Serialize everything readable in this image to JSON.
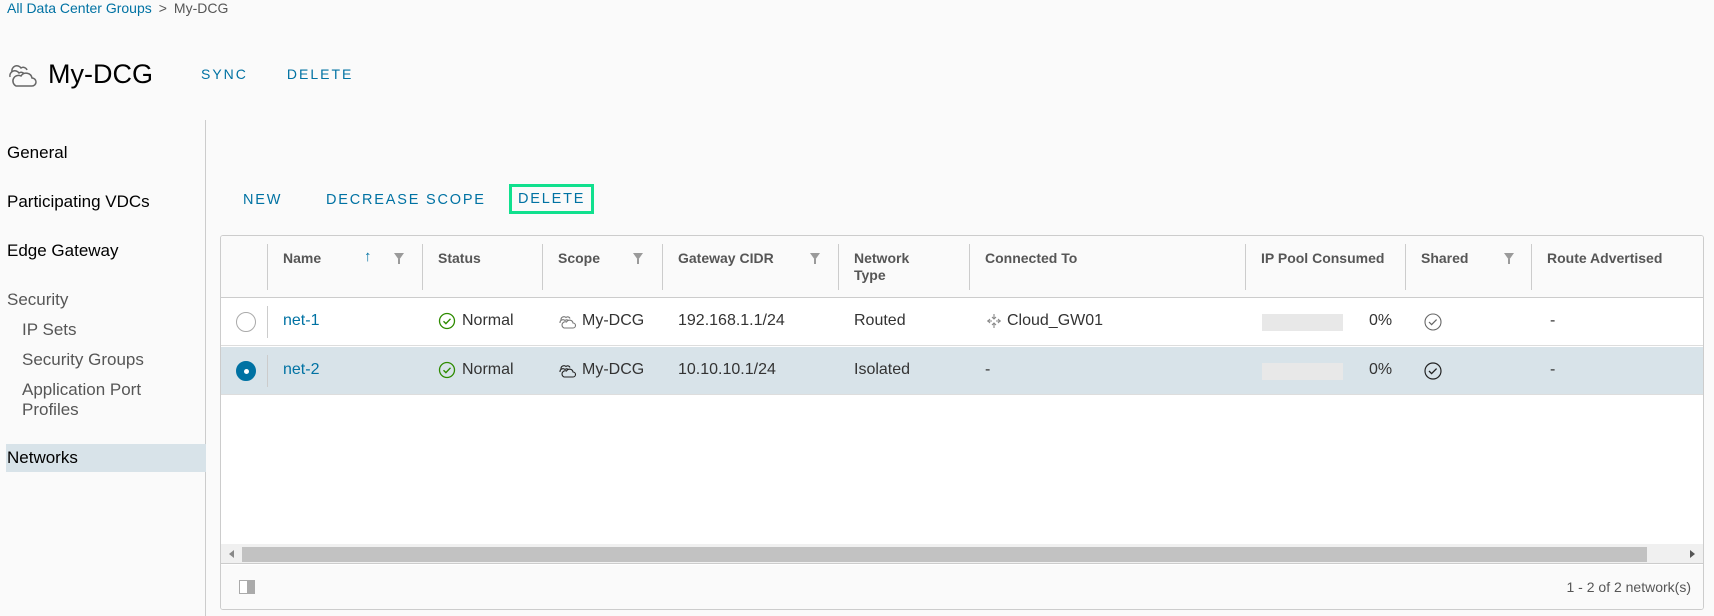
{
  "breadcrumb": {
    "parent": "All Data Center Groups",
    "current": "My-DCG"
  },
  "header": {
    "title": "My-DCG",
    "actions": [
      "SYNC",
      "DELETE"
    ]
  },
  "sidebar": {
    "items": [
      {
        "label": "General"
      },
      {
        "label": "Participating VDCs"
      },
      {
        "label": "Edge Gateway"
      },
      {
        "label": "Security"
      },
      {
        "label": "IP Sets"
      },
      {
        "label": "Security Groups"
      },
      {
        "label": "Application Port Profiles"
      },
      {
        "label": "Networks",
        "active": true
      }
    ]
  },
  "toolbar": {
    "new": "NEW",
    "decrease_scope": "DECREASE SCOPE",
    "delete": "DELETE"
  },
  "table": {
    "columns": [
      "Name",
      "Status",
      "Scope",
      "Gateway CIDR",
      "Network Type",
      "Connected To",
      "IP Pool Consumed",
      "Shared",
      "Route Advertised"
    ],
    "network_type_line1": "Network",
    "network_type_line2": "Type",
    "rows": [
      {
        "name": "net-1",
        "status": "Normal",
        "scope": "My-DCG",
        "cidr": "192.168.1.1/24",
        "type": "Routed",
        "connected": "Cloud_GW01",
        "pool": "0%",
        "route": "-",
        "selected": false
      },
      {
        "name": "net-2",
        "status": "Normal",
        "scope": "My-DCG",
        "cidr": "10.10.10.1/24",
        "type": "Isolated",
        "connected": "-",
        "pool": "0%",
        "route": "-",
        "selected": true
      }
    ],
    "footer_count": "1 - 2 of 2 network(s)"
  },
  "colors": {
    "accent": "#0072a3",
    "highlight": "#10e08e",
    "selected_row": "#d8e3e9",
    "status_ok": "#2e8b00"
  }
}
